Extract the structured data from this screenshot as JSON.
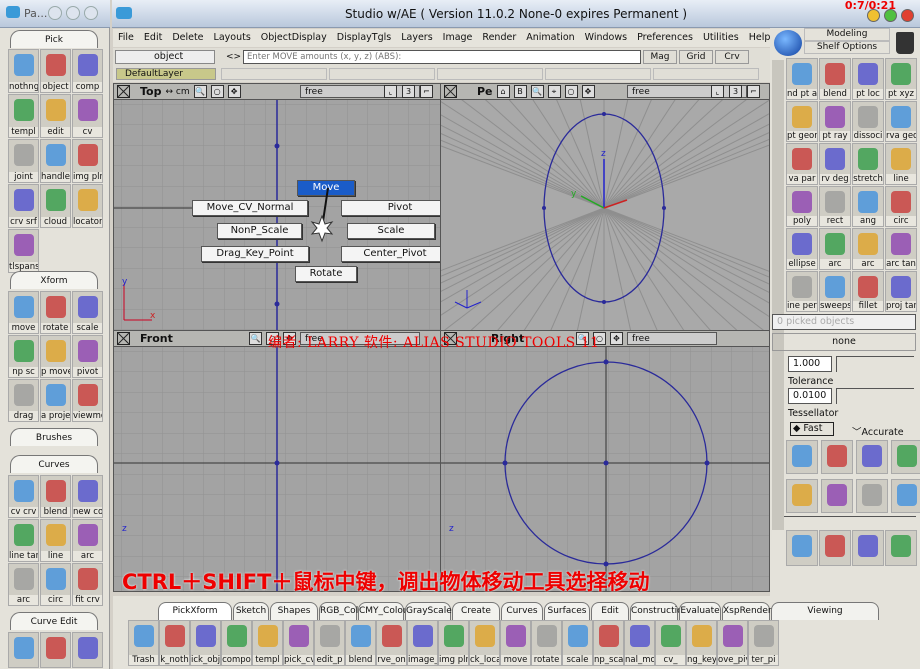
{
  "palette_window": {
    "title": "Pa..."
  },
  "main_window": {
    "title": "Studio w/AE ( Version 11.0.2 None-0 expires Permanent )",
    "timer": "0:7/0:21"
  },
  "menu": [
    "File",
    "Edit",
    "Delete",
    "Layouts",
    "ObjectDisplay",
    "DisplayTgls",
    "Layers",
    "Image",
    "Render",
    "Animation",
    "Windows",
    "Preferences",
    "Utilities",
    "Help"
  ],
  "toolbar": {
    "pick_mode": "object",
    "arrows": "<>",
    "move_placeholder": "Enter MOVE amounts (x, y, z) (ABS):",
    "mag": "Mag",
    "grid": "Grid",
    "crv": "Crv",
    "layer": "DefaultLayer"
  },
  "viewports": {
    "top": {
      "name": "Top",
      "units": "↔ cm",
      "cam": "free",
      "num": "3"
    },
    "persp": {
      "name": "Pe",
      "cam": "free",
      "num": "3"
    },
    "front": {
      "name": "Front",
      "cam": "free"
    },
    "right": {
      "name": "Right",
      "cam": "free"
    }
  },
  "marking_menu": {
    "north": "Move",
    "west_top": "Move_CV_Normal",
    "east_top": "Pivot",
    "west_mid": "NonP_Scale",
    "east_mid": "Scale",
    "west_low": "Drag_Key_Point",
    "east_low": "Center_Pivot",
    "south": "Rotate"
  },
  "watermark": "编者: LARRY 软件: ALIAS STUDIO TOOLS 11",
  "caption": "CTRL＋SHIFT＋鼠标中键，调出物体移动工具选择移动",
  "palette": {
    "pick": {
      "title": "Pick",
      "items": [
        "nothng",
        "object",
        "comp",
        "templ",
        "edit",
        "cv",
        "joint",
        "handle",
        "img pln",
        "crv srf",
        "cloud",
        "locator",
        "tlspanst"
      ]
    },
    "xform": {
      "title": "Xform",
      "items": [
        "move",
        "rotate",
        "scale",
        "np sc",
        "p move",
        "pivot",
        "drag",
        "a projec",
        "viewmov"
      ]
    },
    "brushes": {
      "title": "Brushes"
    },
    "curves": {
      "title": "Curves",
      "items": [
        "cv crv",
        "blend",
        "new cos",
        "line tan",
        "line",
        "arc",
        "arc",
        "circ",
        "fit crv"
      ]
    },
    "curve_edit": {
      "title": "Curve Edit",
      "items": [
        "",
        "",
        ""
      ]
    }
  },
  "shelf_header": {
    "modeling": "Modeling",
    "shelf_options": "Shelf Options"
  },
  "right_shelf": [
    "nd pt a",
    "blend",
    "pt loc",
    "pt xyz",
    "pt geon",
    "pt ray",
    "dissoci",
    "rva geo",
    "va par",
    "rv deg",
    "stretch",
    "line",
    "poly",
    "rect",
    "ang",
    "circ",
    "ellipse",
    "arc",
    "arc",
    "arc tan",
    "ine perp",
    "sweeps",
    "fillet",
    "proj tan"
  ],
  "control_panel": {
    "picked": "0 picked objects",
    "selection": "none",
    "value": "1.000",
    "tolerance_label": "Tolerance",
    "tolerance": "0.0100",
    "tessellator_label": "Tessellator",
    "fast": "Fast",
    "accurate": "Accurate"
  },
  "bottom_tabs": [
    "PickXform",
    "Sketch",
    "Shapes",
    "RGB_Colour",
    "CMY_Colour",
    "GrayScale",
    "Create",
    "Curves",
    "Surfaces",
    "Edit",
    "Construction",
    "Evaluate",
    "XspRender",
    "Viewing"
  ],
  "bottom_icons": [
    "Trash",
    "k_noth",
    "ick_obje",
    "compo",
    "templ",
    "pick_cv",
    "edit_p",
    "blend",
    "rve_on",
    "image_",
    "img pln",
    "ck_locat",
    "move",
    "rotate",
    "scale",
    "np_sca",
    "nal_mo",
    "cv_",
    "ng_key",
    "ove_piv",
    "ter_pi"
  ],
  "colors": {
    "viewport": "#a3a3a3",
    "curve": "#2a2a9a",
    "caption": "#e00000",
    "accent_menu": "#1a5cc8"
  }
}
